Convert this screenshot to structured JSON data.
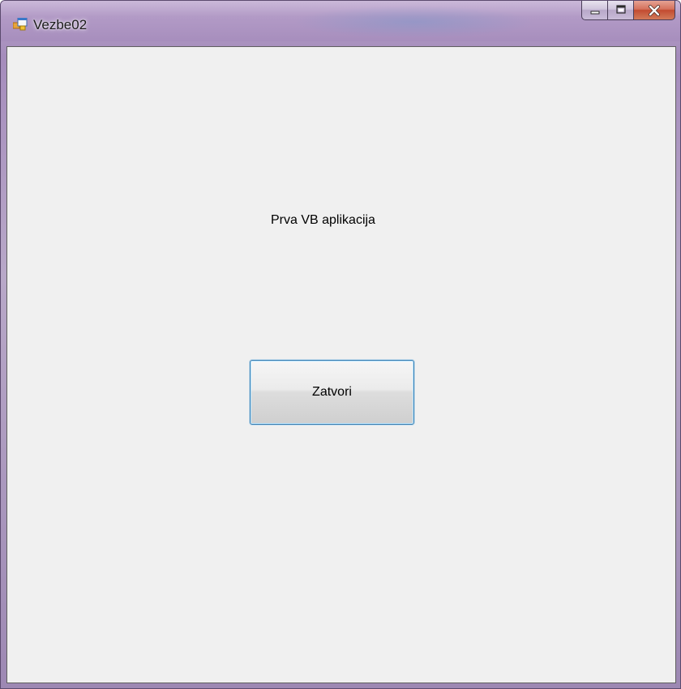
{
  "window": {
    "title": "Vezbe02",
    "icon": "app-form-icon",
    "caption_buttons": [
      "minimize-icon",
      "maximize-icon",
      "close-icon"
    ]
  },
  "form": {
    "label_text": "Prva VB aplikacija",
    "button_label": "Zatvori",
    "background_color": "#f0f0f0",
    "button_focus_color": "#3c7fb1"
  }
}
